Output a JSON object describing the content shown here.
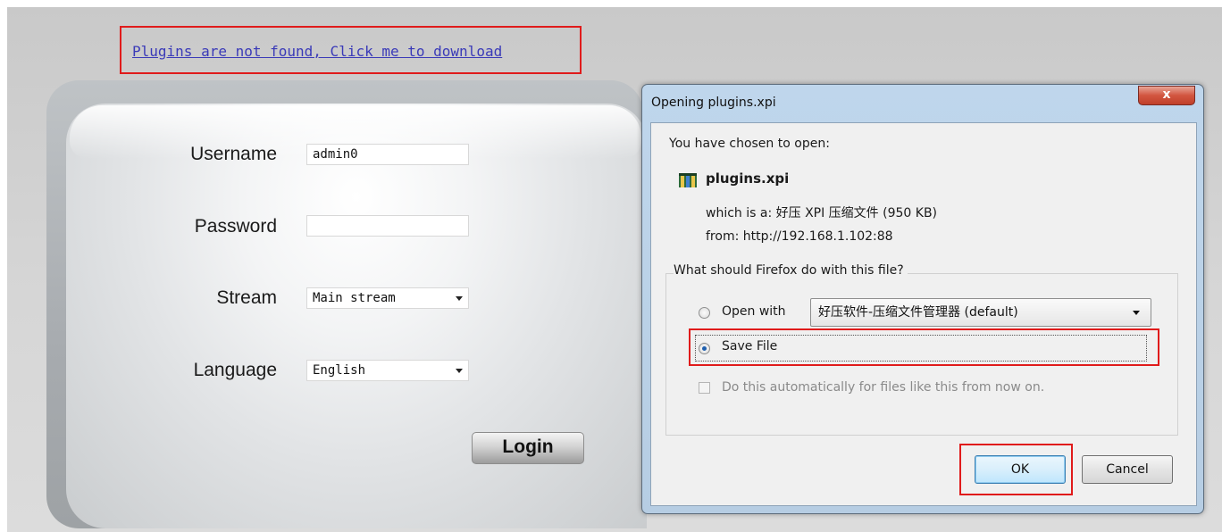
{
  "plugin_notice": {
    "link_text": "Plugins are not found, Click me to download"
  },
  "login": {
    "username_label": "Username",
    "username_value": "admin0",
    "password_label": "Password",
    "password_value": "",
    "stream_label": "Stream",
    "stream_value": "Main stream",
    "language_label": "Language",
    "language_value": "English",
    "login_button": "Login"
  },
  "dialog": {
    "title": "Opening plugins.xpi",
    "close_label": "x",
    "chosen_text": "You have chosen to open:",
    "file_name": "plugins.xpi",
    "file_icon": "archive-file-icon",
    "which_is": "which is a:  好压 XPI 压缩文件 (950 KB)",
    "from": "from:  http://192.168.1.102:88",
    "question": "What should Firefox do with this file?",
    "open_with_label": "Open with",
    "open_with_value": "好压软件-压缩文件管理器 (default)",
    "save_file_label": "Save File",
    "auto_label": "Do this automatically for files like this from now on.",
    "ok_button": "OK",
    "cancel_button": "Cancel",
    "selected_action": "save_file"
  },
  "highlight_color": "#e01b1b"
}
